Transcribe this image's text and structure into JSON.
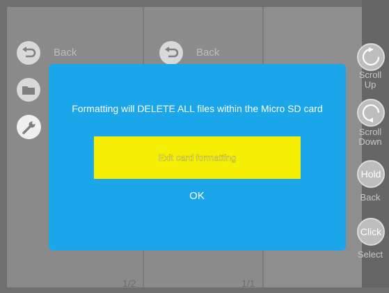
{
  "left_panel": {
    "back_label": "Back",
    "page_indicator": "1/2"
  },
  "mid_panel": {
    "back_label": "Back",
    "page_indicator": "1/1"
  },
  "dialog": {
    "message": "Formatting will DELETE ALL files within the Micro SD card",
    "primary_button": "Exit card formatting",
    "secondary_button": "OK",
    "background_color": "#1ba6ea",
    "primary_color": "#f5ef05"
  },
  "side_controls": [
    {
      "label_line1": "Scroll",
      "label_line2": "Up",
      "icon": "scroll-up-icon"
    },
    {
      "label_line1": "Scroll",
      "label_line2": "Down",
      "icon": "scroll-down-icon"
    },
    {
      "label_line1": "Back",
      "button_text": "Hold"
    },
    {
      "label_line1": "Select",
      "button_text": "Click"
    }
  ]
}
